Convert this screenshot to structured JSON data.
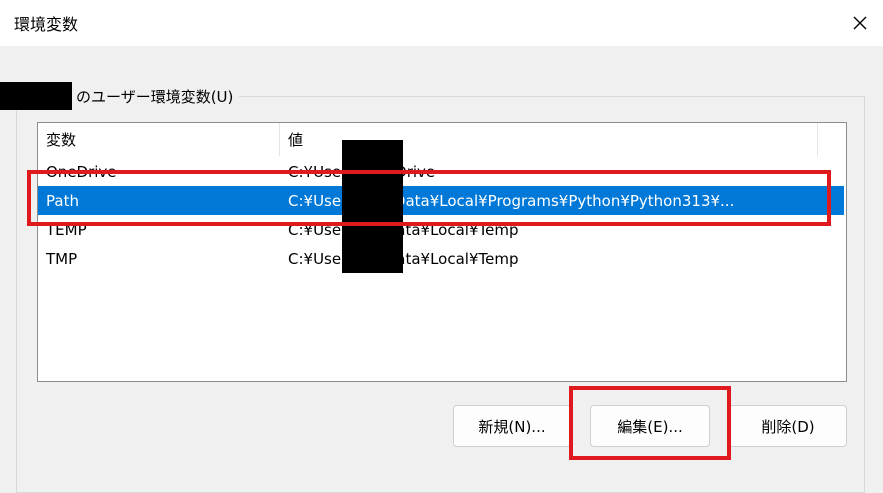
{
  "window": {
    "title": "環境変数"
  },
  "user_vars": {
    "group_label": "のユーザー環境変数(U)",
    "columns": [
      "変数",
      "値"
    ],
    "rows": [
      {
        "name": "OneDrive",
        "value": "C:¥Users¥OneDrive"
      },
      {
        "name": "Path",
        "value": "C:¥Use a¥AppData¥Local¥Programs¥Python¥Python313¥..."
      },
      {
        "name": "TEMP",
        "value": "C:¥Use ¥AppData¥Local¥Temp"
      },
      {
        "name": "TMP",
        "value": "C:¥Use ¥AppData¥Local¥Temp"
      }
    ],
    "selected_row": "Path"
  },
  "buttons": {
    "new_label": "新規(N)...",
    "edit_label": "編集(E)...",
    "delete_label": "削除(D)"
  },
  "colors": {
    "selection": "#0078d7",
    "highlight": "#e0191f"
  }
}
